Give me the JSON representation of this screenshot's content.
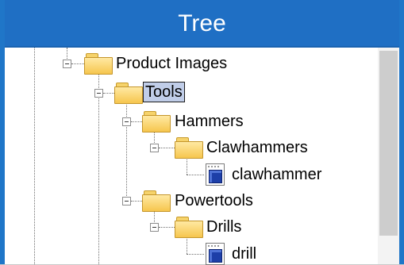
{
  "window": {
    "title": "Tree",
    "accent_color": "#1f6fc4"
  },
  "tree": {
    "nodes": [
      {
        "label": "Product Images",
        "type": "folder",
        "expanded": true,
        "selected": false
      },
      {
        "label": "Tools",
        "type": "folder",
        "expanded": true,
        "selected": true
      },
      {
        "label": "Hammers",
        "type": "folder",
        "expanded": true,
        "selected": false
      },
      {
        "label": "Clawhammers",
        "type": "folder",
        "expanded": true,
        "selected": false
      },
      {
        "label": "clawhammer",
        "type": "file",
        "icon": "model-file-icon",
        "selected": false
      },
      {
        "label": "Powertools",
        "type": "folder",
        "expanded": true,
        "selected": false
      },
      {
        "label": "Drills",
        "type": "folder",
        "expanded": true,
        "selected": false
      },
      {
        "label": "drill",
        "type": "file",
        "icon": "model-file-icon",
        "selected": false
      }
    ]
  }
}
